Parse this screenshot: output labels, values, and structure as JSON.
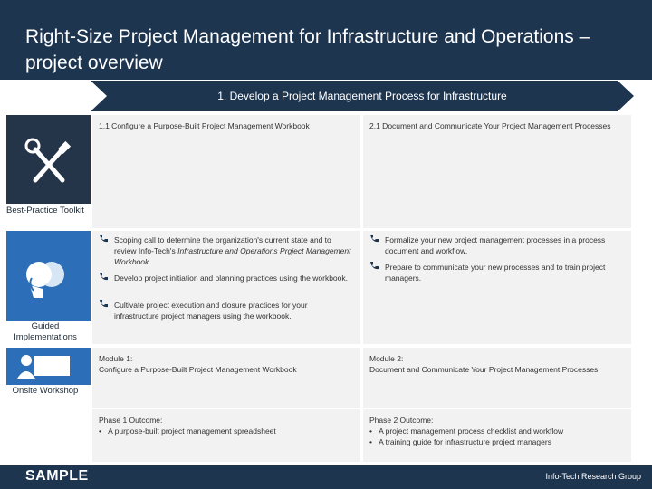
{
  "title": "Right-Size Project Management for Infrastructure and Operations – project overview",
  "banner": "1. Develop a Project Management Process for Infrastructure",
  "rows": {
    "toolkit": {
      "label": "Best-Practice Toolkit",
      "col1": "1.1 Configure a Purpose-Built Project Management Workbook",
      "col2": "2.1 Document and Communicate Your Project Management Processes"
    },
    "guided": {
      "label": "Guided Implementations",
      "col1_items": [
        {
          "pre": "Scoping call to determine the organization's current state and to review Info-Tech's ",
          "em": "Infrastructure and Operations Prgject Management Workbook.",
          "post": ""
        },
        {
          "pre": "Develop project initiation and planning practices using the workbook.",
          "em": "",
          "post": ""
        },
        {
          "pre": "Cultivate project execution and closure practices for your infrastructure project managers using the workbook.",
          "em": "",
          "post": ""
        }
      ],
      "col2_items": [
        "Formalize your new project management processes in a process document and workflow.",
        "Prepare to communicate your new processes and to train project managers."
      ]
    },
    "onsite": {
      "label": "Onsite Workshop",
      "col1_head": "Module 1:",
      "col1_body": "Configure a Purpose-Built Project Management Workbook",
      "col2_head": "Module 2:",
      "col2_body": "Document and Communicate Your Project Management Processes"
    },
    "outcome": {
      "col1_head": "Phase 1 Outcome:",
      "col1_items": [
        "A purpose-built project management spreadsheet"
      ],
      "col2_head": "Phase 2 Outcome:",
      "col2_items": [
        "A project management process checklist and workflow",
        "A training guide for infrastructure project managers"
      ]
    }
  },
  "footer": {
    "sample": "SAMPLE",
    "brand": "Info-Tech Research Group"
  },
  "icons": {
    "toolkit": "tools-icon",
    "guided": "heads-icon",
    "onsite": "presenter-icon",
    "bullet": "phone-icon"
  },
  "colors": {
    "header": "#1e3550",
    "side_dark": "#253549",
    "side_blue": "#2c6fb8",
    "cell": "#f2f2f2"
  }
}
